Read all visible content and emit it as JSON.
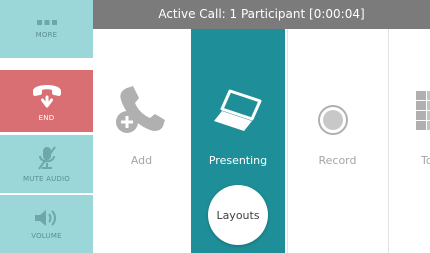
{
  "title": "Active Call: 1 Participant [0:00:04]",
  "sidebar": {
    "more": "MORE",
    "end": "END",
    "mute_audio": "MUTE AUDIO",
    "volume": "VOLUME"
  },
  "panels": {
    "add": "Add",
    "presenting": "Presenting",
    "record": "Record",
    "partial": "To"
  },
  "layouts_button": "Layouts",
  "colors": {
    "teal_light": "#9bd6d9",
    "teal_dark": "#1e8f98",
    "end_red": "#d96f73",
    "title_bar": "#7b7b7b"
  }
}
